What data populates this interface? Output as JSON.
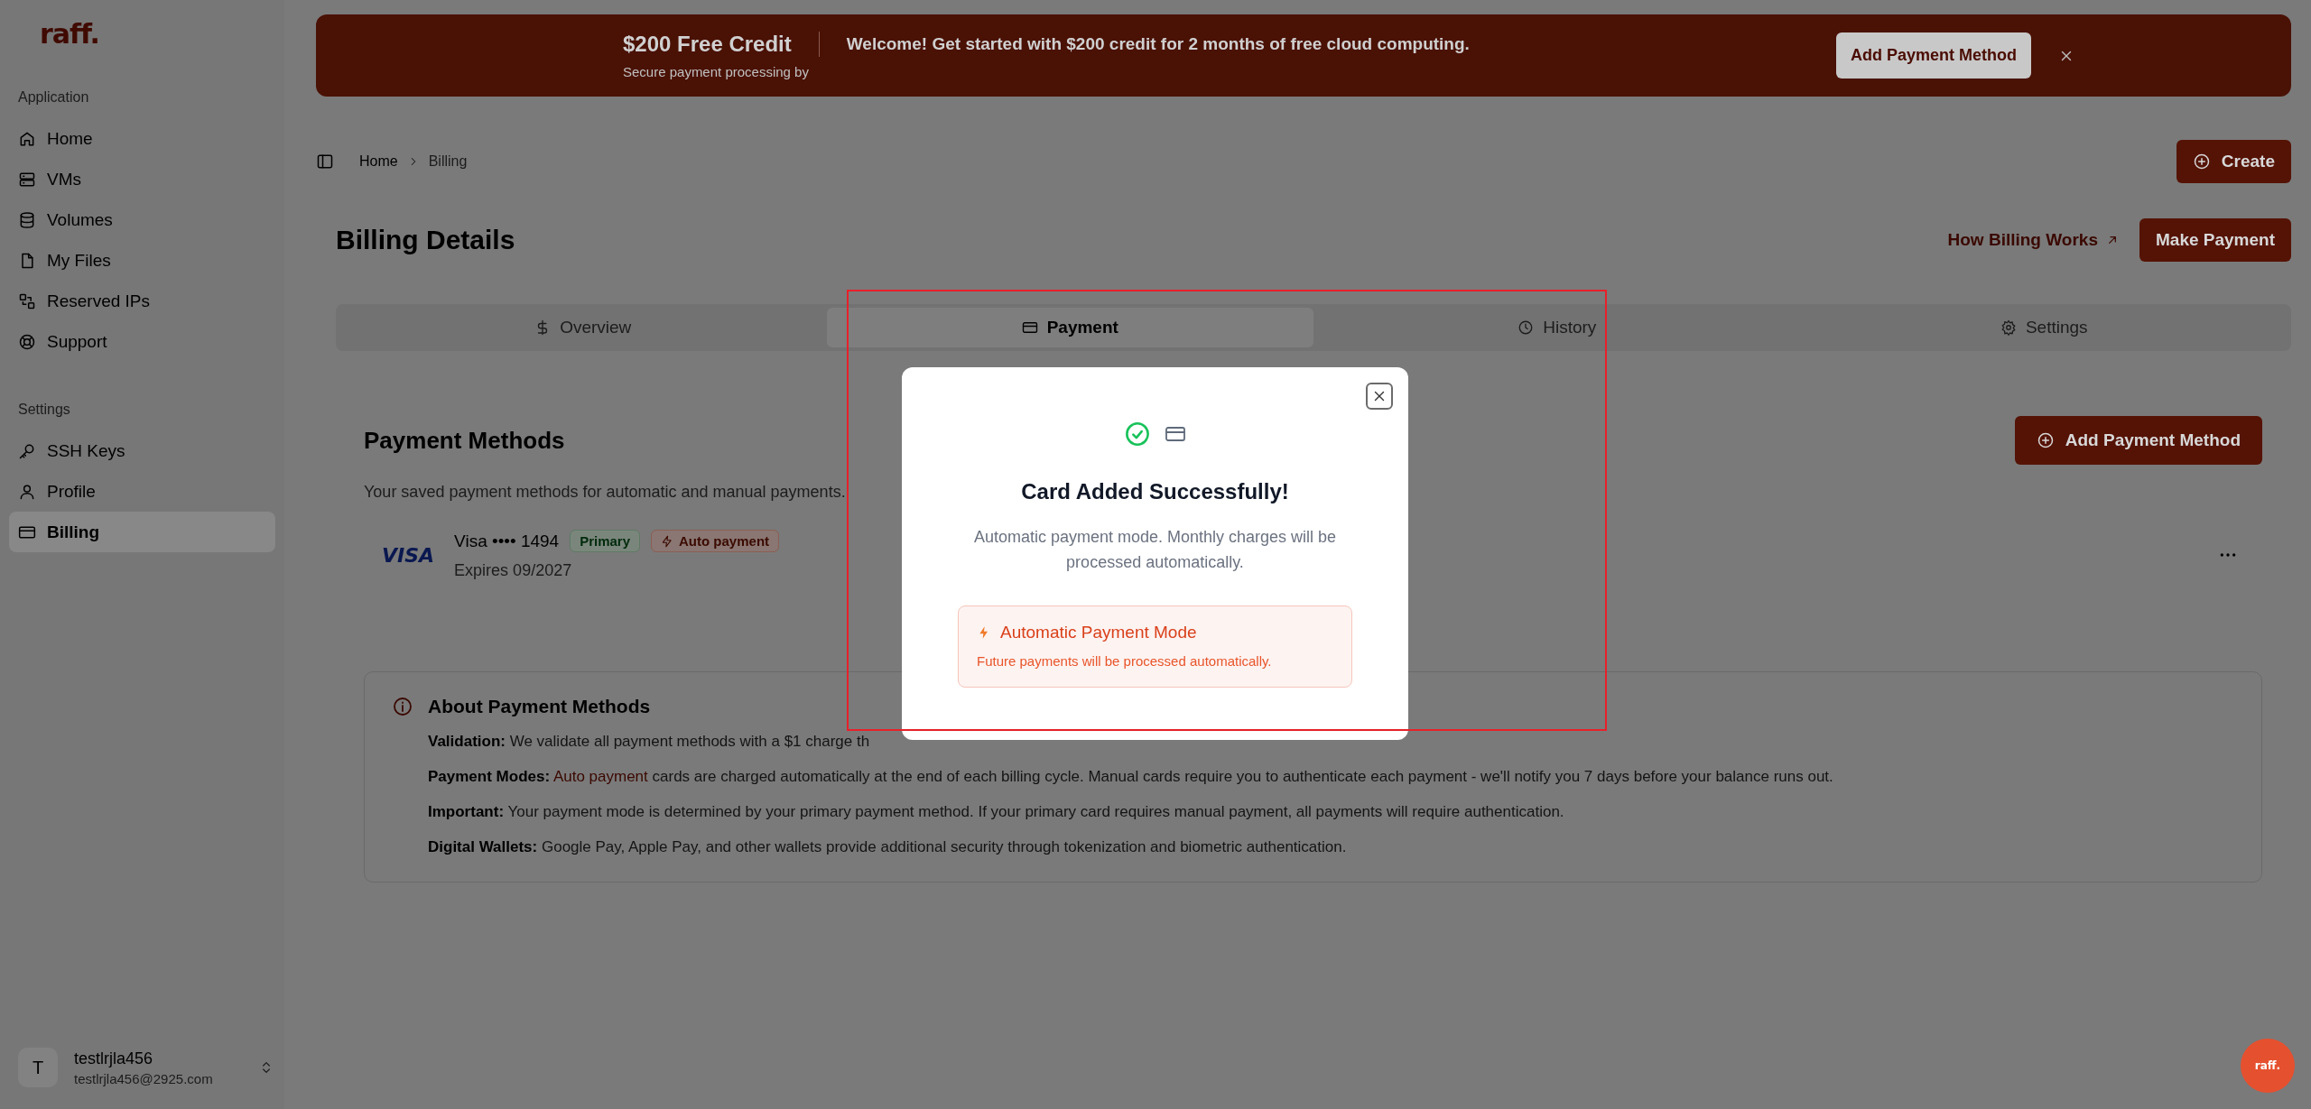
{
  "sidebar": {
    "logo": "raff.",
    "sections": [
      {
        "heading": "Application",
        "items": [
          {
            "label": "Home",
            "selected": false
          },
          {
            "label": "VMs",
            "selected": false
          },
          {
            "label": "Volumes",
            "selected": false
          },
          {
            "label": "My Files",
            "selected": false
          },
          {
            "label": "Reserved IPs",
            "selected": false
          },
          {
            "label": "Support",
            "selected": false
          }
        ]
      },
      {
        "heading": "Settings",
        "items": [
          {
            "label": "SSH Keys",
            "selected": false
          },
          {
            "label": "Profile",
            "selected": false
          },
          {
            "label": "Billing",
            "selected": true
          }
        ]
      }
    ],
    "user": {
      "initial": "T",
      "name": "testlrjla456",
      "email": "testlrjla456@2925.com"
    }
  },
  "banner": {
    "title": "$200 Free Credit",
    "note": "Secure payment processing by",
    "message": "Welcome! Get started with $200 credit for 2 months of free cloud computing.",
    "button": "Add Payment Method"
  },
  "breadcrumb": [
    "Home",
    "Billing"
  ],
  "create_button": "Create",
  "page": {
    "title": "Billing Details",
    "link": "How Billing Works",
    "button": "Make Payment"
  },
  "tabs": [
    {
      "label": "Overview",
      "selected": false
    },
    {
      "label": "Payment",
      "selected": true
    },
    {
      "label": "History",
      "selected": false
    },
    {
      "label": "Settings",
      "selected": false
    }
  ],
  "payment_methods": {
    "title": "Payment Methods",
    "button": "Add Payment Method",
    "subtitle": "Your saved payment methods for automatic and manual payments.",
    "cards": [
      {
        "brand": "VISA",
        "name": "Visa •••• 1494",
        "expires": "Expires 09/2027",
        "badges": [
          {
            "label": "Primary",
            "kind": "primary"
          },
          {
            "label": "Auto payment",
            "kind": "auto"
          }
        ]
      }
    ]
  },
  "about": {
    "title": "About Payment Methods",
    "rows": [
      {
        "label": "Validation:",
        "text": "We validate all payment methods with a $1 charge th"
      },
      {
        "label": "Payment Modes:",
        "highlight": "Auto payment",
        "text": "cards are charged automatically at the end of each billing cycle. Manual cards require you to authenticate each payment - we'll notify you 7 days before your balance runs out."
      },
      {
        "label": "Important:",
        "text": "Your payment mode is determined by your primary payment method. If your primary card requires manual payment, all payments will require authentication."
      },
      {
        "label": "Digital Wallets:",
        "text": "Google Pay, Apple Pay, and other wallets provide additional security through tokenization and biometric authentication."
      }
    ]
  },
  "modal": {
    "title": "Card Added Successfully!",
    "message": "Automatic payment mode. Monthly charges will be processed automatically.",
    "mode": {
      "title": "Automatic Payment Mode",
      "text": "Future payments will be processed automatically."
    }
  },
  "chat_button": "raff."
}
